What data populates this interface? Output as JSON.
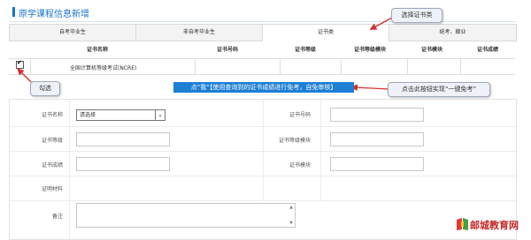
{
  "page": {
    "title": "原学课程信息新增"
  },
  "tabs": [
    {
      "label": "自考毕业生"
    },
    {
      "label": "非自考毕业生"
    },
    {
      "label": "证书类"
    },
    {
      "label": "统考、肄业"
    }
  ],
  "grid": {
    "headers": [
      "证书名称",
      "证书号码",
      "证书等级",
      "证书等级模块",
      "证书模块",
      "证书成绩"
    ],
    "rows": [
      {
        "name": "全国计算机等级考试(NCRE)",
        "checked": "✔"
      }
    ]
  },
  "callouts": {
    "select_cert": "选择证书类",
    "tick": "勾选",
    "banner": "点“我”【使用查询到的证书成绩进行免考，自免审核】",
    "one_click": "点击此按钮实现“一键免考”"
  },
  "form": {
    "cert_name_label": "证书名称",
    "cert_name_value": "请选择",
    "cert_no_label": "证书号码",
    "cert_level_label": "证书等级",
    "cert_level_module_label": "证书等级模块",
    "cert_score_label": "证书成绩",
    "cert_module_label": "证书模块",
    "proof_label": "证明材料",
    "remark_label": "备注"
  },
  "logo": {
    "text": "邮城教育网"
  },
  "colors": {
    "accent": "#1a73c9",
    "banner": "#1e7fd6",
    "arrow": "#d32f2f",
    "logo": "#c62828"
  }
}
